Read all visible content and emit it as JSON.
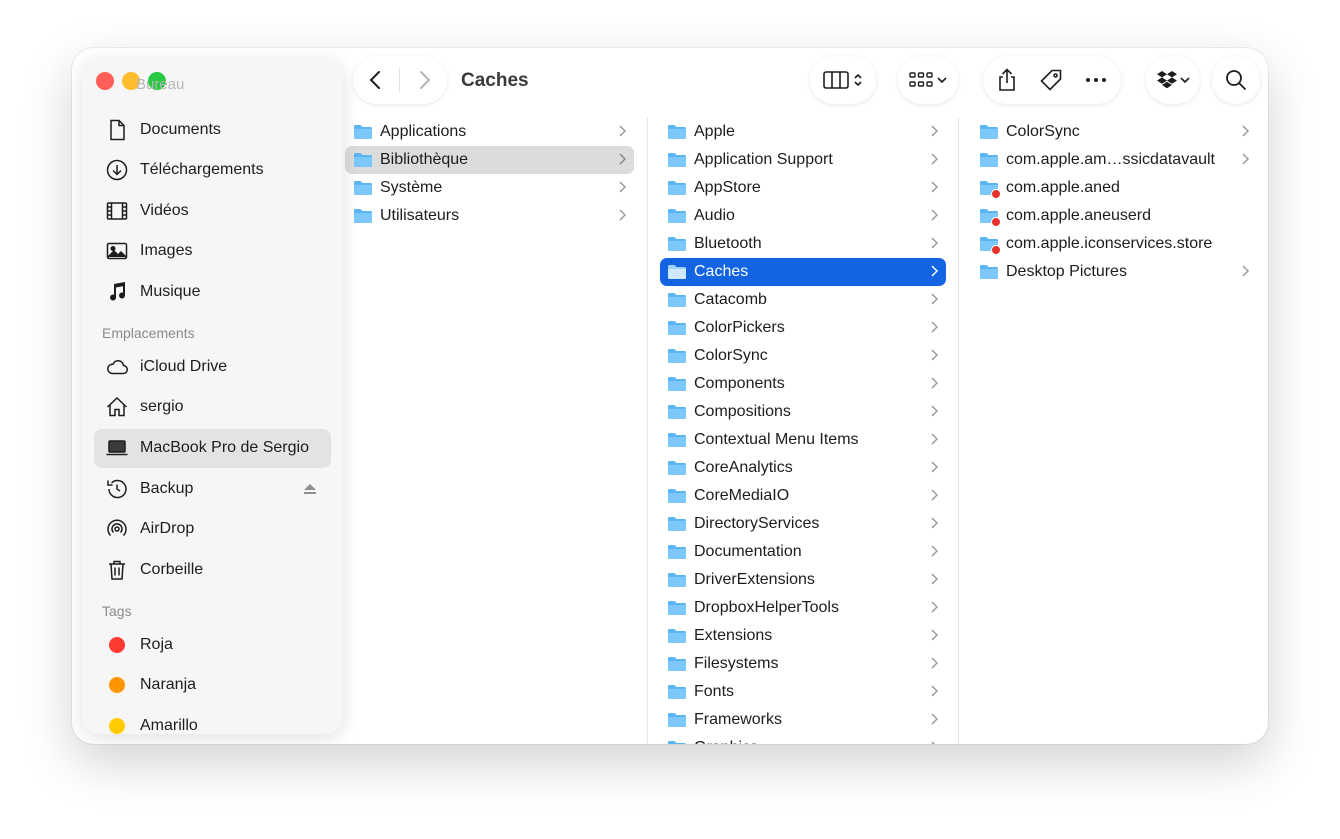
{
  "window": {
    "title": "Caches"
  },
  "sidebar": {
    "partial_top_label": "Bureau",
    "favorites": [
      {
        "label": "Documents",
        "icon": "document-icon"
      },
      {
        "label": "Téléchargements",
        "icon": "download-icon"
      },
      {
        "label": "Vidéos",
        "icon": "film-icon"
      },
      {
        "label": "Images",
        "icon": "photo-icon"
      },
      {
        "label": "Musique",
        "icon": "music-note-icon"
      }
    ],
    "locations_header": "Emplacements",
    "locations": [
      {
        "label": "iCloud Drive",
        "icon": "cloud-icon"
      },
      {
        "label": "sergio",
        "icon": "home-icon"
      },
      {
        "label": "MacBook Pro de Sergio",
        "icon": "laptop-icon",
        "active": true
      },
      {
        "label": "Backup",
        "icon": "time-machine-icon"
      },
      {
        "label": "AirDrop",
        "icon": "airdrop-icon"
      },
      {
        "label": "Corbeille",
        "icon": "trash-icon"
      }
    ],
    "tags_header": "Tags",
    "tags": [
      {
        "label": "Roja",
        "color": "#ff3b30"
      },
      {
        "label": "Naranja",
        "color": "#ff9500"
      },
      {
        "label": "Amarillo",
        "color": "#ffcc00"
      }
    ]
  },
  "columns": {
    "col1": [
      {
        "label": "Applications"
      },
      {
        "label": "Bibliothèque",
        "selected": "gray"
      },
      {
        "label": "Système"
      },
      {
        "label": "Utilisateurs"
      }
    ],
    "col2": [
      {
        "label": "Apple"
      },
      {
        "label": "Application Support"
      },
      {
        "label": "AppStore"
      },
      {
        "label": "Audio"
      },
      {
        "label": "Bluetooth"
      },
      {
        "label": "Caches",
        "selected": "blue"
      },
      {
        "label": "Catacomb"
      },
      {
        "label": "ColorPickers"
      },
      {
        "label": "ColorSync"
      },
      {
        "label": "Components"
      },
      {
        "label": "Compositions"
      },
      {
        "label": "Contextual Menu Items"
      },
      {
        "label": "CoreAnalytics"
      },
      {
        "label": "CoreMediaIO"
      },
      {
        "label": "DirectoryServices"
      },
      {
        "label": "Documentation"
      },
      {
        "label": "DriverExtensions"
      },
      {
        "label": "DropboxHelperTools"
      },
      {
        "label": "Extensions"
      },
      {
        "label": "Filesystems"
      },
      {
        "label": "Fonts"
      },
      {
        "label": "Frameworks"
      },
      {
        "label": "Graphics"
      }
    ],
    "col3": [
      {
        "label": "ColorSync",
        "chevron": true
      },
      {
        "label": "com.apple.am…ssicdatavault",
        "chevron": true
      },
      {
        "label": "com.apple.aned",
        "restricted": true
      },
      {
        "label": "com.apple.aneuserd",
        "restricted": true
      },
      {
        "label": "com.apple.iconservices.store",
        "restricted": true
      },
      {
        "label": "Desktop Pictures",
        "chevron": true
      }
    ]
  },
  "colors": {
    "accent": "#1264e2",
    "folder": "#5bb6f5",
    "selection_gray": "#dcdcdc"
  }
}
